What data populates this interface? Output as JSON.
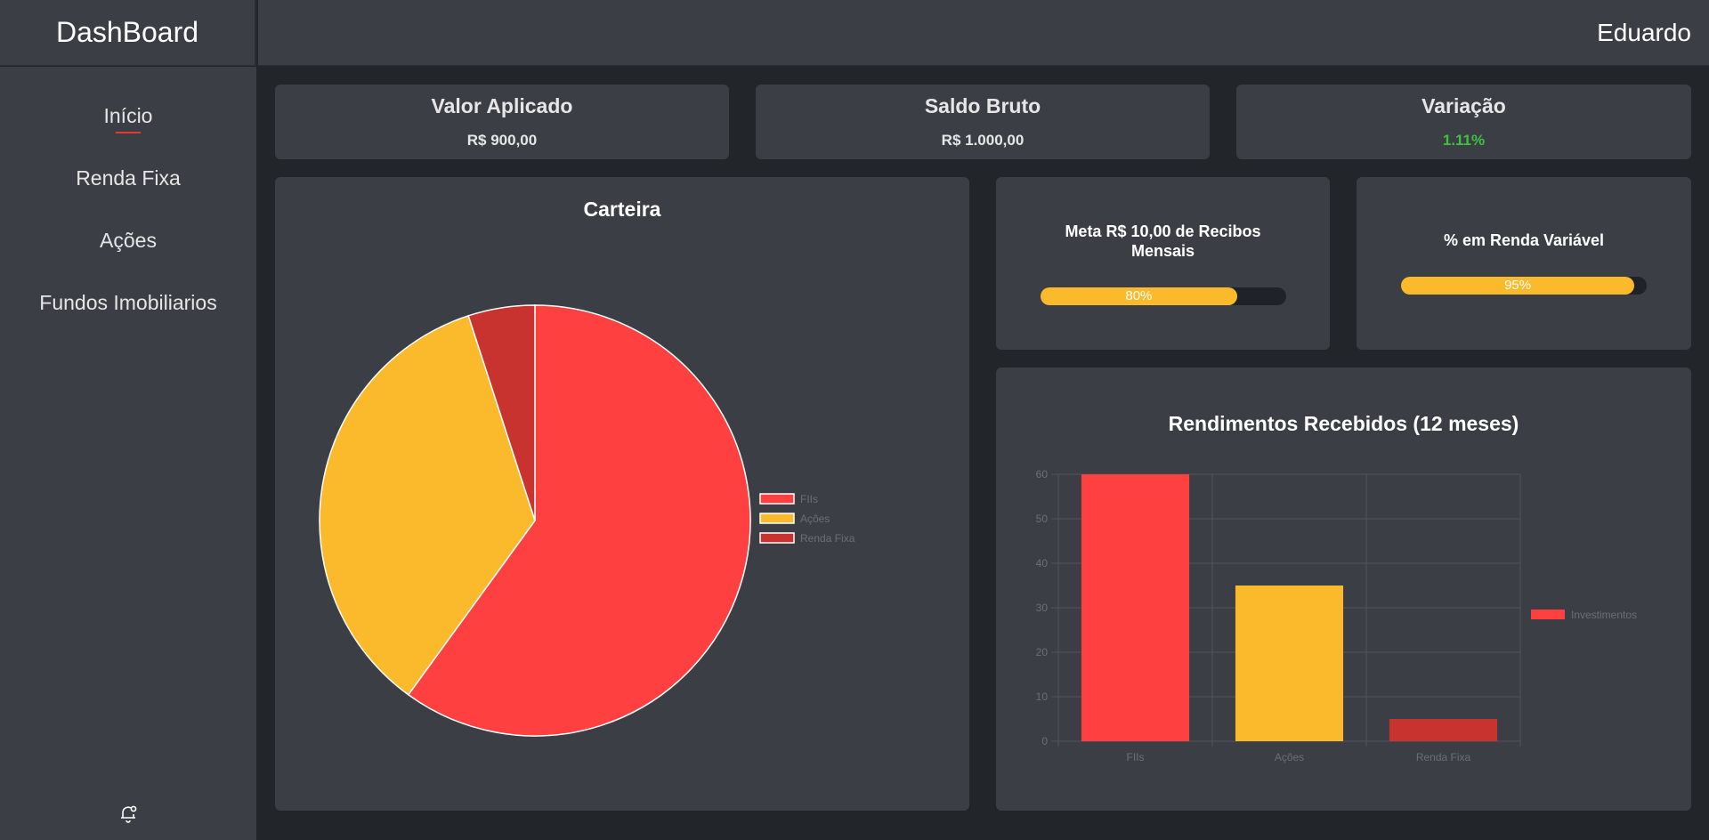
{
  "app": {
    "brand": "DashBoard",
    "user": "Eduardo"
  },
  "sidebar": {
    "items": [
      {
        "label": "Início",
        "active": true
      },
      {
        "label": "Renda Fixa",
        "active": false
      },
      {
        "label": "Ações",
        "active": false
      },
      {
        "label": "Fundos Imobiliarios",
        "active": false
      }
    ],
    "bell_icon": "bell-settings-icon"
  },
  "kpis": {
    "aplicado": {
      "title": "Valor Aplicado",
      "value": "R$ 900,00"
    },
    "saldo": {
      "title": "Saldo Bruto",
      "value": "R$ 1.000,00"
    },
    "variacao": {
      "title": "Variação",
      "value": "1.11%",
      "color": "#3ec23e"
    }
  },
  "goals": {
    "recibos": {
      "title": "Meta R$ 10,00 de Recibos Mensais",
      "label": "80%",
      "value": 0.8
    },
    "renda_variavel": {
      "title": "% em Renda Variável",
      "label": "95%",
      "value": 0.95
    }
  },
  "colors": {
    "red": "#ff4040",
    "yellow": "#fbba2b",
    "darkred": "#c83330"
  },
  "chart_data": [
    {
      "type": "pie",
      "title": "Carteira",
      "categories": [
        "FIIs",
        "Ações",
        "Renda Fixa"
      ],
      "values": [
        60,
        35,
        5
      ],
      "colors": [
        "#ff4040",
        "#fbba2b",
        "#c83330"
      ],
      "legend": "right"
    },
    {
      "type": "bar",
      "title": "Rendimentos Recebidos (12 meses)",
      "categories": [
        "FIIs",
        "Ações",
        "Renda Fixa"
      ],
      "series": [
        {
          "name": "Investimentos",
          "values": [
            60,
            35,
            5
          ]
        }
      ],
      "colors": [
        "#ff4040",
        "#fbba2b",
        "#c83330"
      ],
      "ylim": [
        0,
        60
      ],
      "yticks": [
        "0",
        "10",
        "20",
        "30",
        "40",
        "50",
        "60"
      ],
      "grid": true,
      "legend": "right"
    }
  ]
}
